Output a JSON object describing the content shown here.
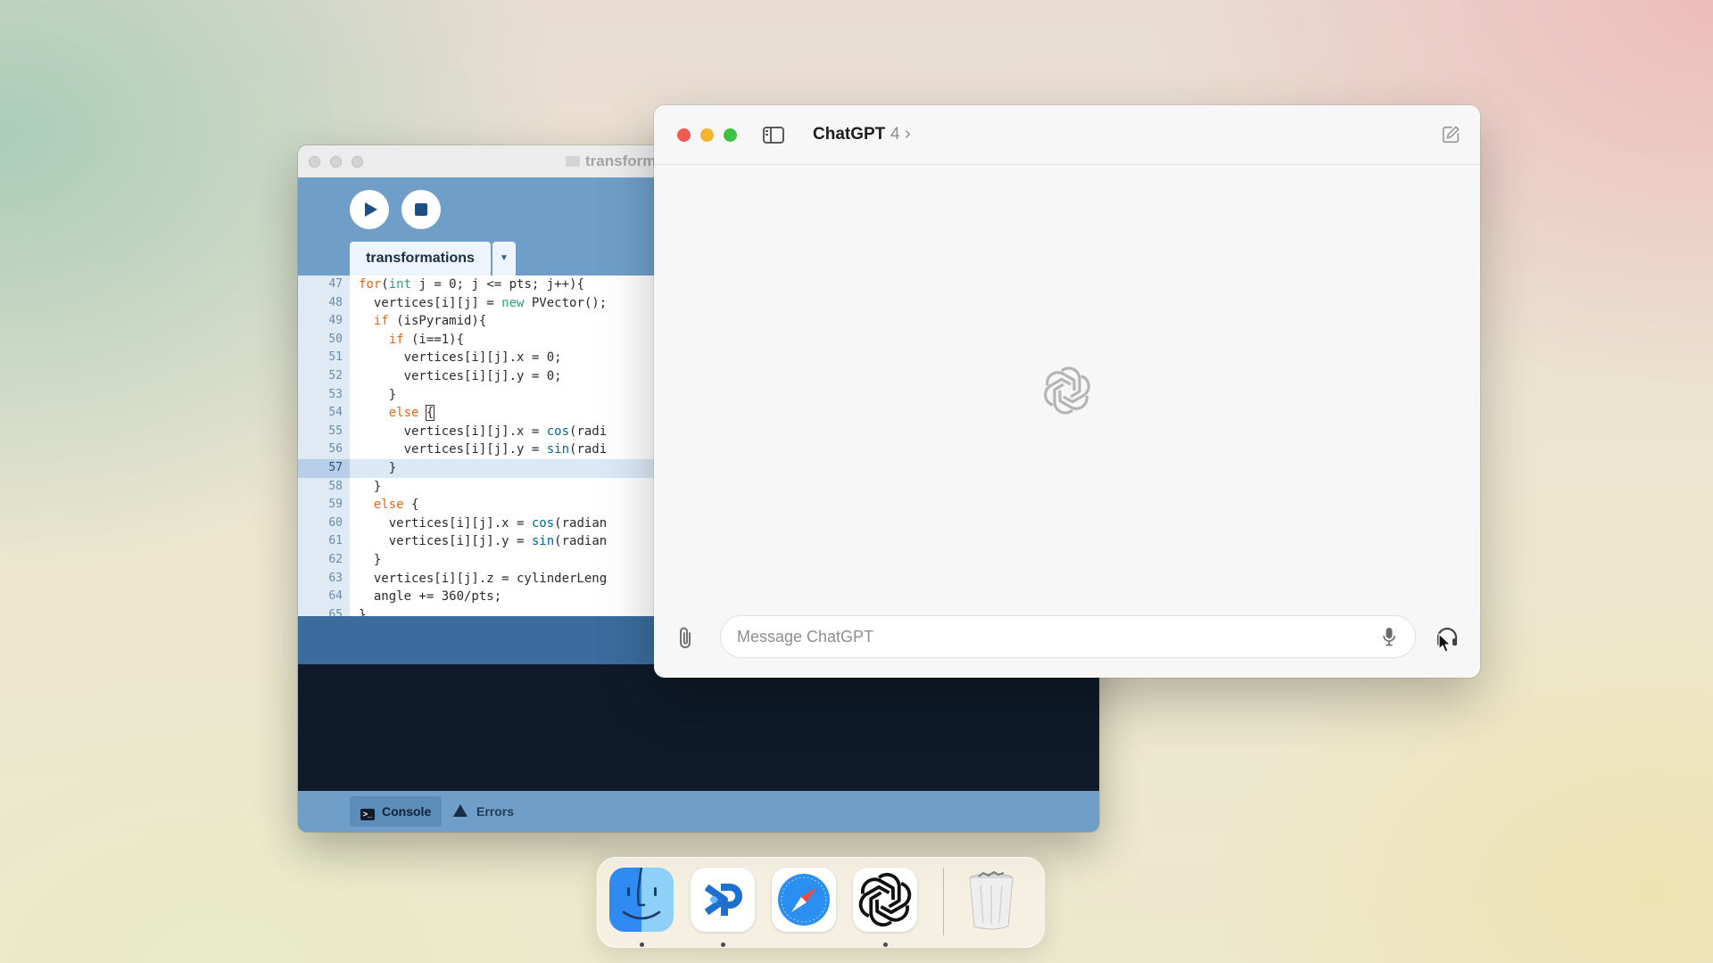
{
  "ide": {
    "window_title": "transformations",
    "tab_label": "transformations",
    "code_lines": [
      {
        "num": "47",
        "html": "<span class=\"kw2\">for</span>(<span class=\"kw\">int</span> j = 0; j &lt;= pts; j++){"
      },
      {
        "num": "48",
        "html": "  vertices[i][j] = <span class=\"kw\">new</span> PVector();"
      },
      {
        "num": "49",
        "html": "  <span class=\"kw2\">if</span> (isPyramid){"
      },
      {
        "num": "50",
        "html": "    <span class=\"kw2\">if</span> (i==1){"
      },
      {
        "num": "51",
        "html": "      vertices[i][j].x = 0;"
      },
      {
        "num": "52",
        "html": "      vertices[i][j].y = 0;"
      },
      {
        "num": "53",
        "html": "    }"
      },
      {
        "num": "54",
        "html": "    <span class=\"kw2\">else</span> <span class=\"cursor-box\">{</span>"
      },
      {
        "num": "55",
        "html": "      vertices[i][j].x = <span class=\"fn\">cos</span>(radi"
      },
      {
        "num": "56",
        "html": "      vertices[i][j].y = <span class=\"fn\">sin</span>(radi"
      },
      {
        "num": "57",
        "html": "    }",
        "active": true
      },
      {
        "num": "58",
        "html": "  }"
      },
      {
        "num": "59",
        "html": "  <span class=\"kw2\">else</span> {"
      },
      {
        "num": "60",
        "html": "    vertices[i][j].x = <span class=\"fn\">cos</span>(radian"
      },
      {
        "num": "61",
        "html": "    vertices[i][j].y = <span class=\"fn\">sin</span>(radian"
      },
      {
        "num": "62",
        "html": "  }"
      },
      {
        "num": "63",
        "html": "  vertices[i][j].z = cylinderLeng"
      },
      {
        "num": "64",
        "html": "  angle += 360/pts;"
      },
      {
        "num": "65",
        "html": "}"
      }
    ],
    "console_tab": "Console",
    "errors_tab": "Errors"
  },
  "chatgpt": {
    "title": "ChatGPT",
    "version": "4",
    "chevron": "›",
    "input_placeholder": "Message ChatGPT",
    "input_value": ""
  },
  "dock": {
    "apps": [
      "finder-icon",
      "processing-icon",
      "safari-icon",
      "chatgpt-icon",
      "trash-icon"
    ]
  },
  "colors": {
    "ide_blue": "#6f9fc9",
    "ide_dark": "#0f1b2a",
    "traffic_red": "#ee5b52",
    "traffic_yellow": "#f3b42f",
    "traffic_green": "#3fc244"
  }
}
